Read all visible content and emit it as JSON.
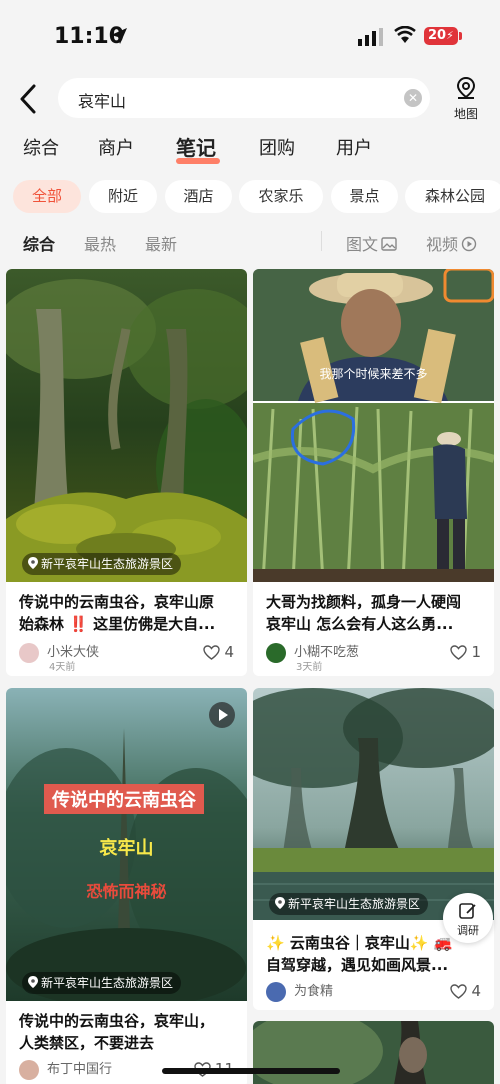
{
  "status_bar": {
    "time": "11:10",
    "battery": "20"
  },
  "search": {
    "query": "哀牢山",
    "map_label": "地图"
  },
  "main_tabs": [
    "综合",
    "商户",
    "笔记",
    "团购",
    "用户"
  ],
  "active_main_tab": "笔记",
  "chips": [
    "全部",
    "附近",
    "酒店",
    "农家乐",
    "景点",
    "森林公园"
  ],
  "sort": {
    "comprehensive": "综合",
    "hottest": "最热",
    "newest": "最新",
    "image_text": "图文",
    "video": "视频"
  },
  "cards": [
    {
      "location": "新平哀牢山生态旅游景区",
      "title_line1": "传说中的云南虫谷，哀牢山原",
      "title_line2": "始森林 ‼️ 这里仿佛是大自...",
      "author": "小米大侠",
      "time": "4天前",
      "likes": "4"
    },
    {
      "caption": "我那个时候来差不多",
      "title_line1": "大哥为找颜料，孤身一人硬闯",
      "title_line2": "哀牢山 怎么会有人这么勇...",
      "author": "小糊不吃葱",
      "time": "3天前",
      "likes": "1"
    },
    {
      "overlay_line1": "传说中的云南虫谷",
      "overlay_line2": "哀牢山",
      "overlay_line3": "恐怖而神秘",
      "location": "新平哀牢山生态旅游景区",
      "title_line1": "传说中的云南虫谷，哀牢山，",
      "title_line2": "人类禁区，不要进去",
      "author": "布丁中国行",
      "likes": "11"
    },
    {
      "location": "新平哀牢山生态旅游景区",
      "title_line1": "✨ 云南虫谷｜哀牢山✨ 🚒",
      "title_line2": "自驾穿越，遇见如画风景...",
      "author": "为食精",
      "likes": "4"
    }
  ],
  "research_label": "调研",
  "colors": {
    "accent": "#f0533a",
    "chip_active_bg": "#fde4dc",
    "background": "#f4f4f4"
  },
  "icons": [
    "location-arrow-icon",
    "signal-icon",
    "wifi-icon",
    "back-arrow-icon",
    "clear-icon",
    "map-pin-icon",
    "image-icon",
    "play-circle-icon",
    "heart-icon",
    "location-pin-icon",
    "play-icon",
    "edit-icon"
  ]
}
